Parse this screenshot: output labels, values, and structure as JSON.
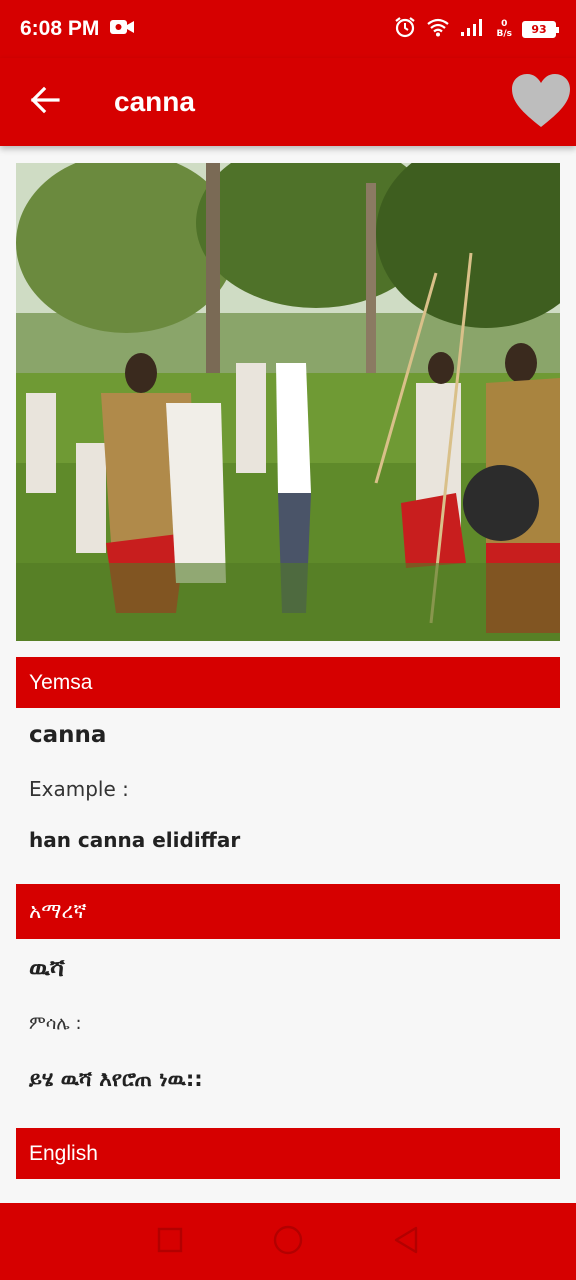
{
  "status_bar": {
    "time": "6:08 PM",
    "net_speed_value": "0",
    "net_speed_unit": "B/s",
    "battery": "93"
  },
  "app_bar": {
    "title": "canna"
  },
  "sections": {
    "yemsa": {
      "header": "Yemsa",
      "word": "canna",
      "example_label": "Example :",
      "example": "han canna elidiffar"
    },
    "amharic": {
      "header": "አማረኛ",
      "word": "ዉሻ",
      "example_label": "ምሳሌ :",
      "example": "ይሄ ዉሻ እየሮጠ ነዉ::"
    },
    "english": {
      "header": "English"
    }
  },
  "colors": {
    "primary": "#d60000",
    "background": "#f7f7f7"
  }
}
